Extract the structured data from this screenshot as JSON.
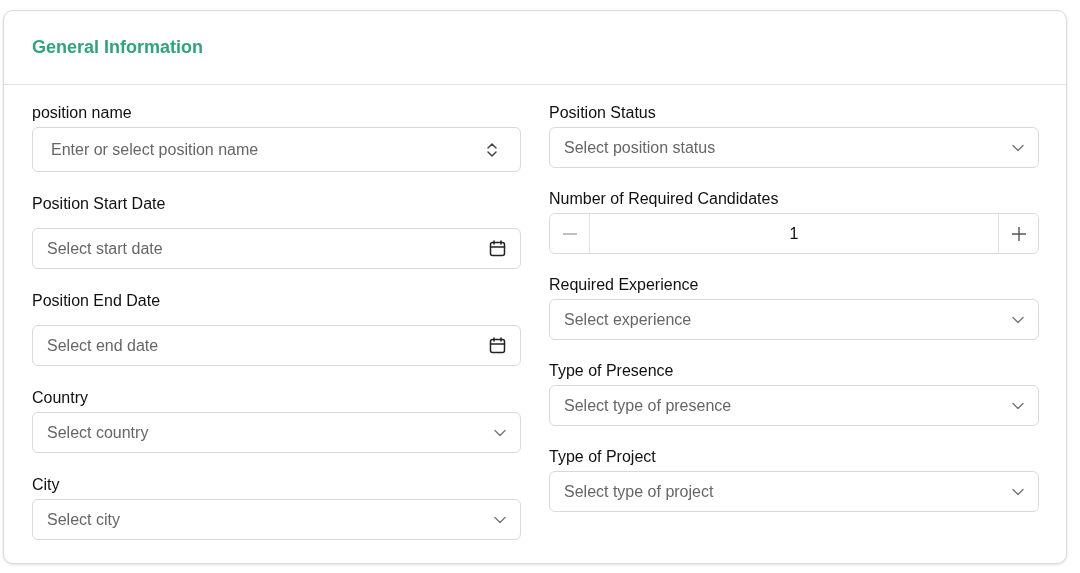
{
  "section": {
    "title": "General Information"
  },
  "columns": [
    {
      "fields": [
        {
          "kind": "combobox",
          "label": "position name",
          "placeholder": "Enter or select position name"
        },
        {
          "kind": "date",
          "label": "Position Start Date",
          "placeholder": "Select start date"
        },
        {
          "kind": "date",
          "label": "Position End Date",
          "placeholder": "Select end date"
        },
        {
          "kind": "select",
          "label": "Country",
          "placeholder": "Select country"
        },
        {
          "kind": "select",
          "label": "City",
          "placeholder": "Select city"
        }
      ]
    },
    {
      "fields": [
        {
          "kind": "select",
          "label": "Position Status",
          "placeholder": "Select position status"
        },
        {
          "kind": "stepper",
          "label": "Number of Required Candidates",
          "value": "1"
        },
        {
          "kind": "select",
          "label": "Required Experience",
          "placeholder": "Select experience"
        },
        {
          "kind": "select",
          "label": "Type of Presence",
          "placeholder": "Select type of presence"
        },
        {
          "kind": "select",
          "label": "Type of Project",
          "placeholder": "Select type of project"
        }
      ]
    }
  ]
}
